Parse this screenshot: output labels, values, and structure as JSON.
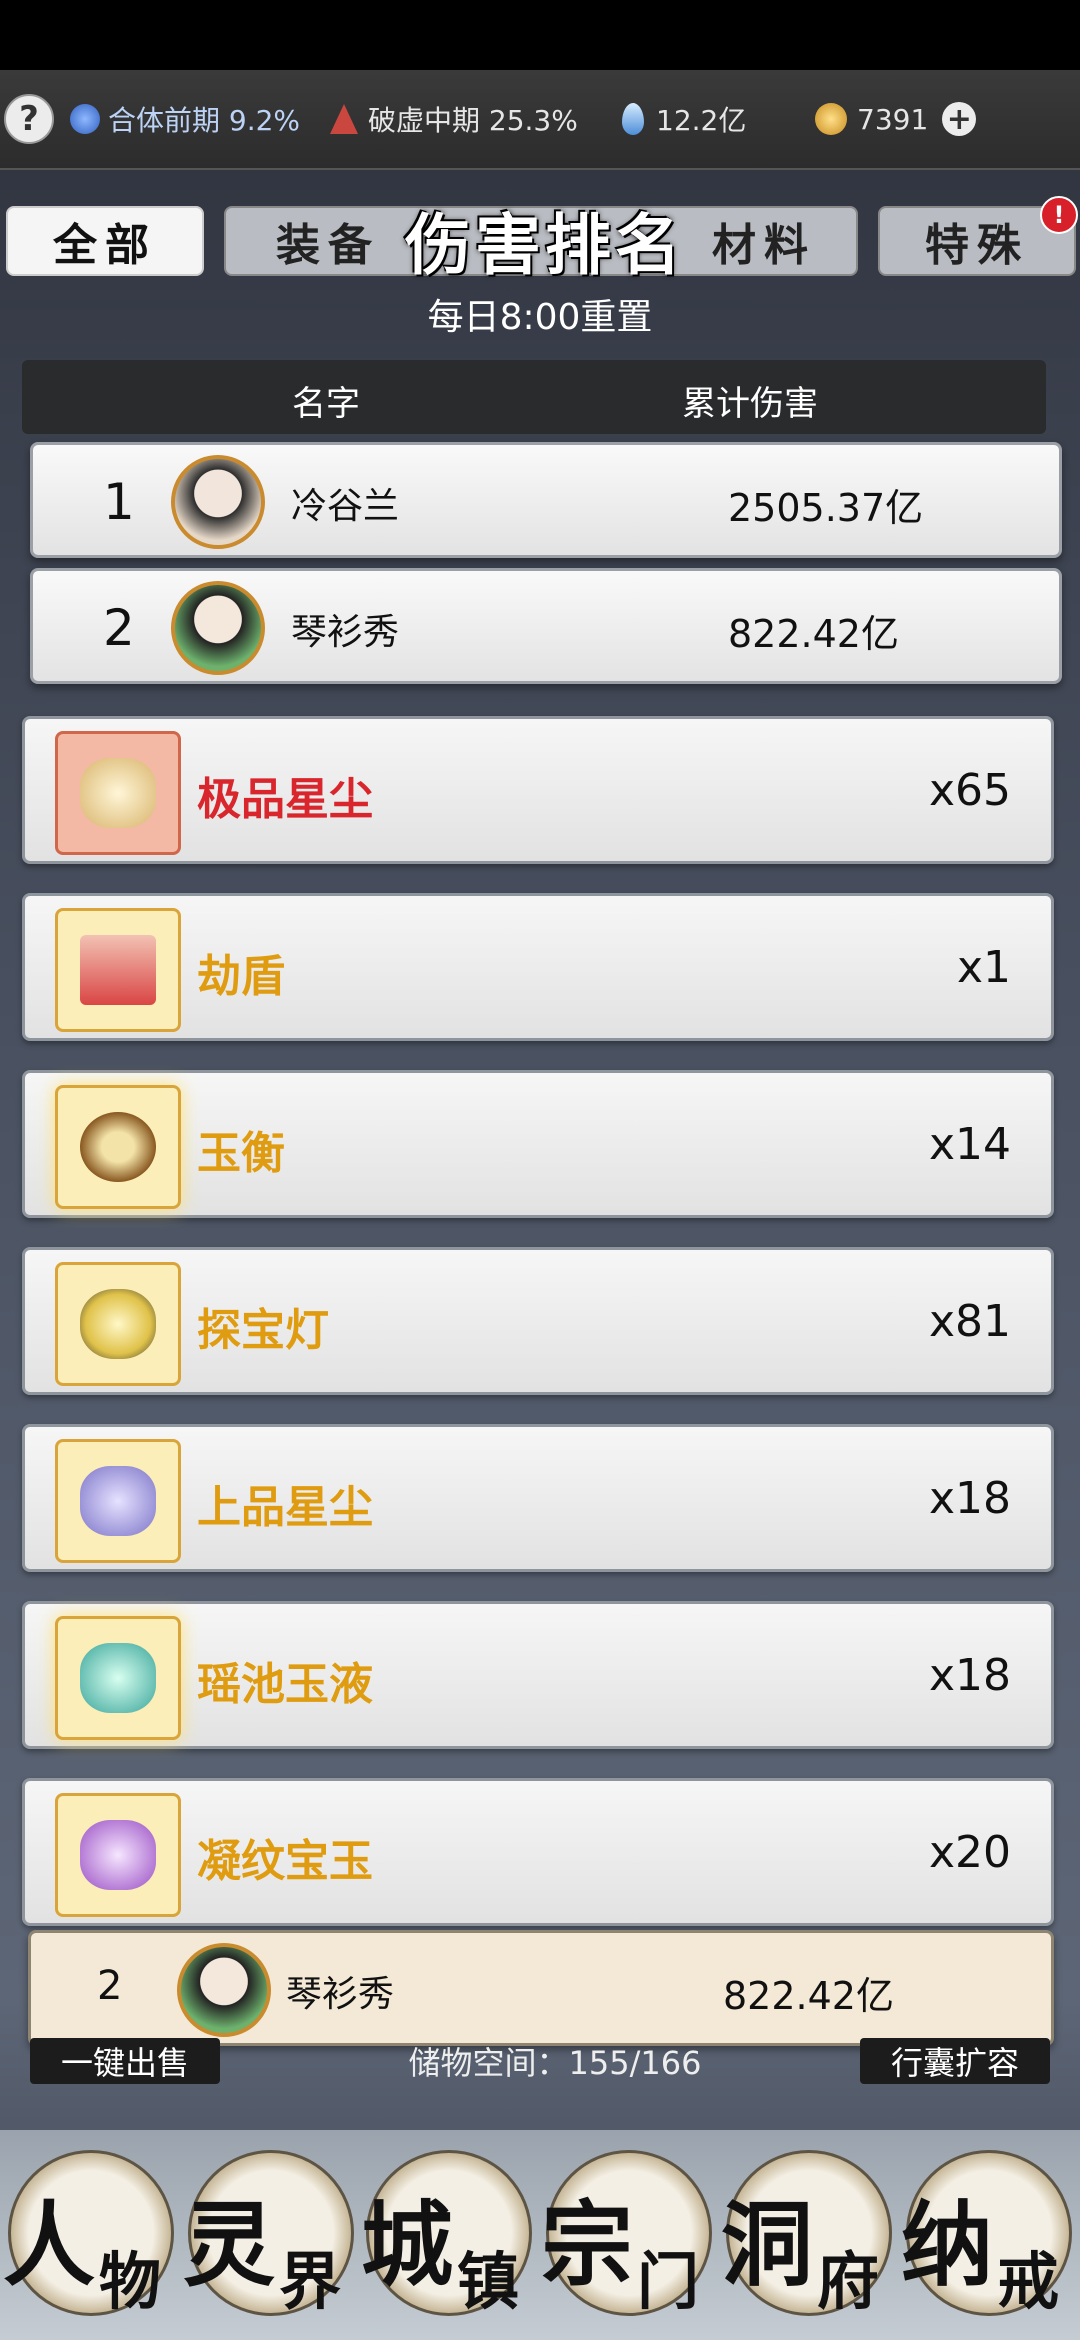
{
  "status": {
    "help": "?",
    "realm": "合体前期 9.2%",
    "tribulation": "破虚中期 25.3%",
    "spirit_stone": "12.2亿",
    "gold": "7391",
    "plus": "+"
  },
  "tabs": {
    "all": "全部",
    "equip": "装备",
    "material": "材料",
    "special": "特殊",
    "badge": "!"
  },
  "ranking": {
    "title": "伤害排名",
    "reset": "每日8:00重置",
    "col_name": "名字",
    "col_damage": "累计伤害",
    "rows": [
      {
        "rank": "1",
        "name": "冷谷兰",
        "damage": "2505.37亿"
      },
      {
        "rank": "2",
        "name": "琴衫秀",
        "damage": "822.42亿"
      }
    ],
    "self": {
      "rank": "2",
      "name": "琴衫秀",
      "damage": "822.42亿"
    }
  },
  "items": [
    {
      "name": "极品星尘",
      "qty": "x65"
    },
    {
      "name": "劫盾",
      "qty": "x1"
    },
    {
      "name": "玉衡",
      "qty": "x14"
    },
    {
      "name": "探宝灯",
      "qty": "x81"
    },
    {
      "name": "上品星尘",
      "qty": "x18"
    },
    {
      "name": "瑶池玉液",
      "qty": "x18"
    },
    {
      "name": "凝纹宝玉",
      "qty": "x20"
    }
  ],
  "bottom": {
    "sell_all": "一键出售",
    "storage": "储物空间：155/166",
    "expand": "行囊扩容"
  },
  "nav": [
    {
      "a": "人",
      "b": "物"
    },
    {
      "a": "灵",
      "b": "界"
    },
    {
      "a": "城",
      "b": "镇"
    },
    {
      "a": "宗",
      "b": "门"
    },
    {
      "a": "洞",
      "b": "府"
    },
    {
      "a": "纳",
      "b": "戒"
    }
  ]
}
